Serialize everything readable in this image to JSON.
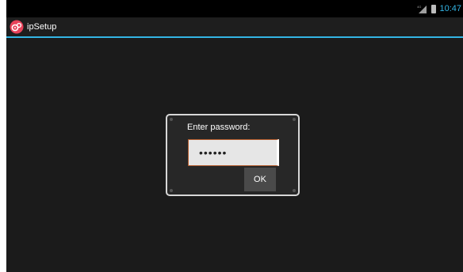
{
  "status_bar": {
    "time": "10:47",
    "icons": [
      "signal-icon",
      "battery-icon"
    ],
    "time_color": "#33b5e5"
  },
  "action_bar": {
    "app_icon": "ipsetup-logo-icon",
    "title": "ipSetup",
    "accent_color": "#33b5e5"
  },
  "dialog": {
    "label": "Enter password:",
    "password_masked": "••••••",
    "ok_label": "OK"
  }
}
